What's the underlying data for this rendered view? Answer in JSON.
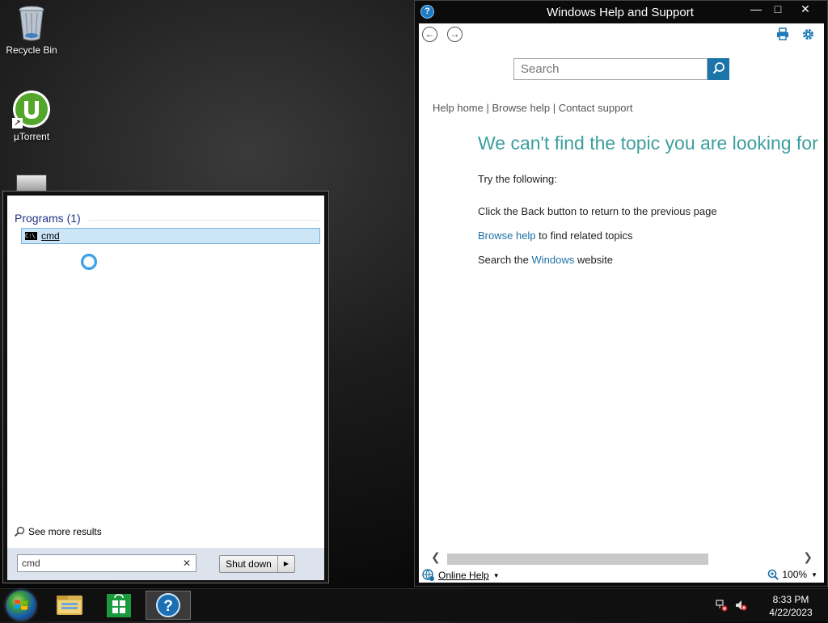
{
  "desktop": {
    "icons": [
      {
        "label": "Recycle Bin"
      },
      {
        "label": "µTorrent"
      },
      {
        "label": ""
      }
    ]
  },
  "start_menu": {
    "section_header": "Programs (1)",
    "results": [
      {
        "label": "cmd"
      }
    ],
    "see_more": "See more results",
    "search_value": "cmd",
    "clear_glyph": "✕",
    "shutdown_label": "Shut down",
    "shutdown_arrow": "▶"
  },
  "help_window": {
    "title": "Windows Help and Support",
    "controls": {
      "minimize": "—",
      "maximize": "□",
      "close": "✕"
    },
    "search_placeholder": "Search",
    "breadcrumbs": {
      "help_home": "Help home",
      "browse_help": "Browse help",
      "contact_support": "Contact support",
      "separator": "|"
    },
    "heading": "We can't find the topic you are looking for",
    "try_following": "Try the following:",
    "line1": "Click the Back button to return to the previous page",
    "line2_link": "Browse help",
    "line2_rest": " to find related topics",
    "line3_pre": "Search the ",
    "line3_link": "Windows",
    "line3_post": " website",
    "status": {
      "online_help": "Online Help",
      "zoom": "100%"
    }
  },
  "taskbar": {
    "pinned": [
      "file-explorer",
      "windows-store",
      "help-and-support"
    ],
    "clock": {
      "time": "8:33 PM",
      "date": "4/22/2023"
    }
  },
  "colors": {
    "accent_blue": "#1c75a8",
    "heading_teal": "#3d9e9e",
    "link_blue": "#1d71a6",
    "selection": "#cce6f7"
  }
}
